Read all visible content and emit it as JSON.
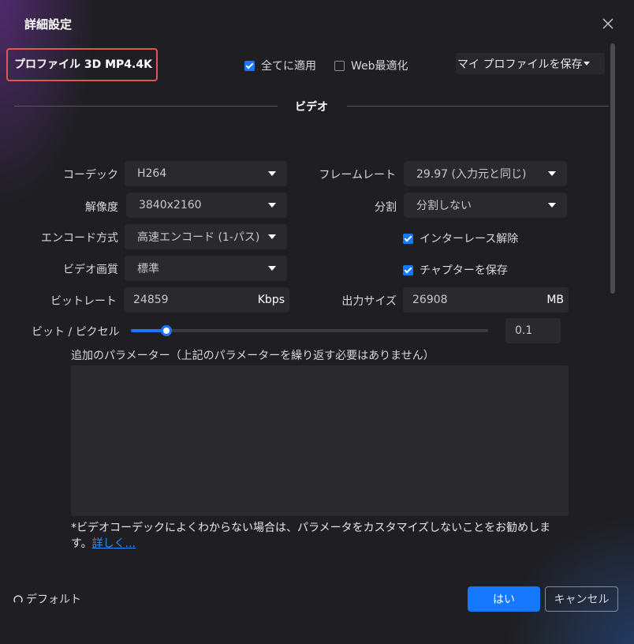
{
  "dialog": {
    "title": "詳細設定",
    "close_icon": "close-icon"
  },
  "profile": {
    "label": "プロファイル  3D MP4.4K"
  },
  "header_options": {
    "apply_all": {
      "label": "全てに適用",
      "checked": true
    },
    "web_optimize": {
      "label": "Web最適化",
      "checked": false
    },
    "save_profile_label": "マイ プロファイルを保存"
  },
  "section": {
    "video_title": "ビデオ"
  },
  "fields": {
    "codec": {
      "label": "コーデック",
      "value": "H264"
    },
    "resolution": {
      "label": "解像度",
      "value": "3840x2160"
    },
    "encode_mode": {
      "label": "エンコード方式",
      "value": "高速エンコード (1-パス)"
    },
    "video_quality": {
      "label": "ビデオ画質",
      "value": "標準"
    },
    "bitrate": {
      "label": "ビットレート",
      "value": "24859",
      "unit": "Kbps"
    },
    "framerate": {
      "label": "フレームレート",
      "value": "29.97 (入力元と同じ)"
    },
    "split": {
      "label": "分割",
      "value": "分割しない"
    },
    "deinterlace": {
      "label": "インターレース解除",
      "checked": true
    },
    "keep_chapters": {
      "label": "チャプターを保存",
      "checked": true
    },
    "output_size": {
      "label": "出力サイズ",
      "value": "26908",
      "unit": "MB"
    }
  },
  "bits_per_pixel": {
    "label": "ビット / ピクセル",
    "value": "0.1",
    "slider_fraction": 0.1
  },
  "params": {
    "label": "追加のパラメーター（上記のパラメーターを繰り返す必要はありません）",
    "value": ""
  },
  "note": {
    "text": "*ビデオコーデックによくわからない場合は、パラメータをカスタマイズしないことをお勧めします。",
    "link": "詳しく..."
  },
  "footer": {
    "default_label": "デフォルト",
    "yes_label": "はい",
    "cancel_label": "キャンセル"
  },
  "colors": {
    "accent": "#1677ff",
    "highlight_border": "#e25555",
    "background": "#1f1f23"
  }
}
